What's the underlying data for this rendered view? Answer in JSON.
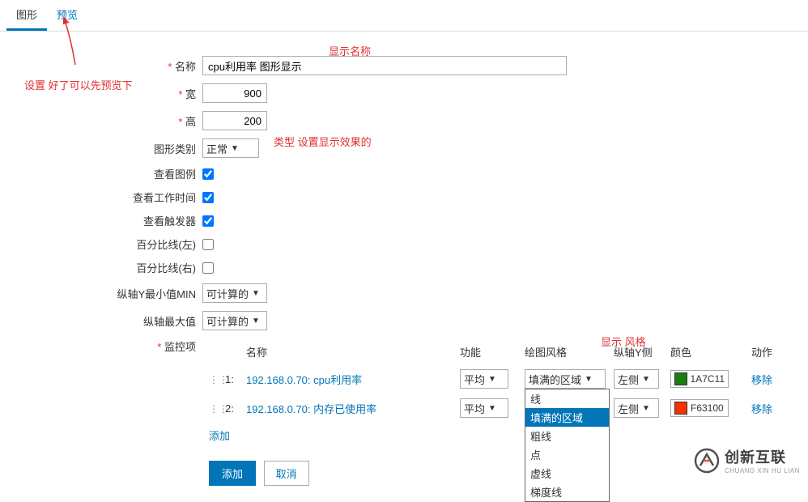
{
  "tabs": {
    "graph": "图形",
    "preview": "预览"
  },
  "annotations": {
    "preview_hint": "设置 好了可以先预览下",
    "name_hint": "显示名称",
    "type_hint": "类型 设置显示效果的",
    "style_hint": "显示 风格"
  },
  "form": {
    "name": {
      "label": "名称",
      "value": "cpu利用率 图形显示"
    },
    "width": {
      "label": "宽",
      "value": "900"
    },
    "height": {
      "label": "高",
      "value": "200"
    },
    "graph_type": {
      "label": "图形类别",
      "value": "正常"
    },
    "show_legend": {
      "label": "查看图例",
      "checked": true
    },
    "show_worktime": {
      "label": "查看工作时间",
      "checked": true
    },
    "show_trigger": {
      "label": "查看触发器",
      "checked": true
    },
    "percent_left": {
      "label": "百分比线(左)",
      "checked": false
    },
    "percent_right": {
      "label": "百分比线(右)",
      "checked": false
    },
    "y_min": {
      "label": "纵轴Y最小值MIN",
      "value": "可计算的"
    },
    "y_max": {
      "label": "纵轴最大值",
      "value": "可计算的"
    },
    "monitor_label": "监控项"
  },
  "table": {
    "headers": {
      "name": "名称",
      "func": "功能",
      "style": "绘图风格",
      "yaxis": "纵轴Y侧",
      "color": "颜色",
      "action": "动作"
    },
    "rows": [
      {
        "idx": "1:",
        "name": "192.168.0.70: cpu利用率",
        "func": "平均",
        "style": "填满的区域",
        "yaxis": "左侧",
        "color": "1A7C11",
        "swatch": "#1A7C11",
        "action": "移除"
      },
      {
        "idx": "2:",
        "name": "192.168.0.70: 内存已使用率",
        "func": "平均",
        "style": "填满的区域",
        "yaxis": "左侧",
        "color": "F63100",
        "swatch": "#F63100",
        "action": "移除"
      }
    ],
    "dropdown_options": [
      "线",
      "填满的区域",
      "粗线",
      "点",
      "虚线",
      "梯度线"
    ],
    "add_link": "添加"
  },
  "buttons": {
    "add": "添加",
    "cancel": "取消"
  },
  "watermark": {
    "cn": "创新互联",
    "en": "CHUANG XIN HU LIAN"
  }
}
